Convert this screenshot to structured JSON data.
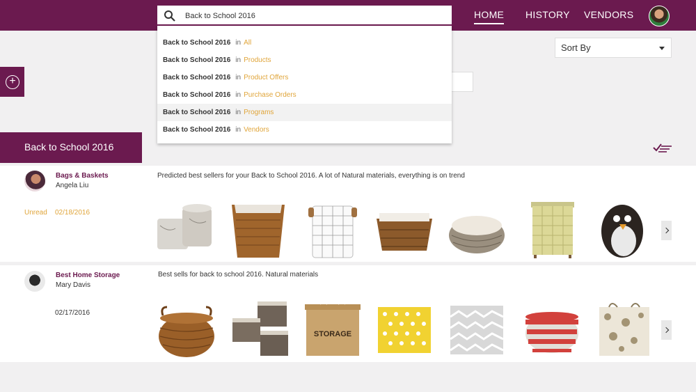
{
  "header": {
    "search_value": "Back to School 2016",
    "nav": {
      "home": "HOME",
      "history": "HISTORY",
      "vendors": "VENDORS"
    }
  },
  "search_suggestions": [
    {
      "term": "Back to School 2016",
      "in": "in",
      "category": "All"
    },
    {
      "term": "Back to School 2016",
      "in": "in",
      "category": "Products"
    },
    {
      "term": "Back to School 2016",
      "in": "in",
      "category": "Product Offers"
    },
    {
      "term": "Back to School 2016",
      "in": "in",
      "category": "Purchase Orders"
    },
    {
      "term": "Back to School 2016",
      "in": "in",
      "category": "Programs"
    },
    {
      "term": "Back to School 2016",
      "in": "in",
      "category": "Vendors"
    }
  ],
  "sort": {
    "label": "Sort By"
  },
  "campaign_tab": {
    "label": "Back to School 2016"
  },
  "cards": [
    {
      "vendor": "Bags & Baskets",
      "person": "Angela Liu",
      "status": "Unread",
      "date": "02/18/2016",
      "description": "Predicted best sellers for your Back to School 2016. A lot of Natural materials, everything is on trend",
      "products": [
        "marble-storage-ottomans",
        "wicker-hamper-with-liner",
        "grid-laundry-hamper",
        "wicker-basket-with-handles",
        "oval-wicker-basket",
        "green-woven-hamper",
        "penguin-hamper"
      ]
    },
    {
      "vendor": "Best Home Storage",
      "person": "Mary Davis",
      "status": "",
      "date": "02/17/2016",
      "description": "Best sells for back to school 2016. Natural materials",
      "products": [
        "round-wicker-basket",
        "brown-fabric-storage-bins",
        "jute-storage-bin",
        "yellow-polka-dot-bin",
        "gray-chevron-bin",
        "red-striped-basket",
        "floral-canvas-bin"
      ],
      "product_text": {
        "jute-storage-bin": "STORAGE"
      }
    }
  ],
  "colors": {
    "brand": "#6b1a4f",
    "accent": "#e0a53a",
    "background": "#f1f0f1"
  }
}
